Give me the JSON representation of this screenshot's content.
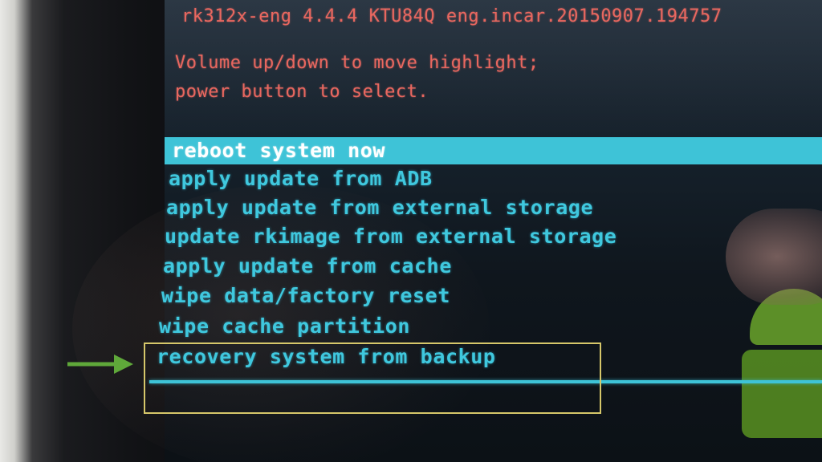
{
  "recovery": {
    "build_line": "rk312x-eng 4.4.4 KTU84Q eng.incar.20150907.194757",
    "instructions": [
      "Volume up/down to move highlight;",
      "power button to select."
    ],
    "menu_items": [
      "reboot system now",
      "apply update from ADB",
      "apply update from external storage",
      "update rkimage from external storage",
      "apply update from cache",
      "wipe data/factory reset",
      "wipe cache partition",
      "recovery system from backup"
    ],
    "highlighted_index": 0,
    "annotated_index": 7
  },
  "colors": {
    "header_text": "#e9675f",
    "menu_text": "#3fc8de",
    "highlight_bar": "#3ec3d7",
    "callout_border": "#d6c76a",
    "arrow": "#5fa83a"
  },
  "icons": {
    "annotation_arrow": "arrow-right-icon"
  }
}
